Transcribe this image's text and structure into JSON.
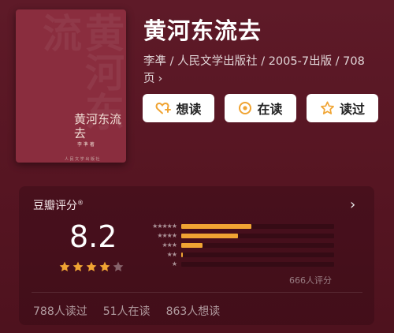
{
  "book": {
    "title": "黄河东流去",
    "meta_line": "李凖 / 人民文学出版社 / 2005-7出版 / 708页",
    "cover": {
      "title": "黄河东流去",
      "author": "李 凖 著",
      "publisher": "人 民 文 学 出 版 社"
    }
  },
  "actions": {
    "want_label": "想读",
    "reading_label": "在读",
    "read_label": "读过"
  },
  "rating": {
    "label": "豆瓣评分",
    "reg_mark": "®",
    "score": "8.2",
    "stars_filled": 4,
    "distribution": [
      {
        "stars": "★★★★★",
        "fraction": 0.46
      },
      {
        "stars": "★★★★",
        "fraction": 0.37
      },
      {
        "stars": "★★★",
        "fraction": 0.14
      },
      {
        "stars": "★★",
        "fraction": 0.01
      },
      {
        "stars": "★",
        "fraction": 0.0
      }
    ],
    "raters": "666人评分"
  },
  "stats": {
    "read": "788人读过",
    "reading": "51人在读",
    "want": "863人想读"
  },
  "colors": {
    "accent": "#f0a433",
    "background": "#5a1624",
    "button": "#ffffff"
  }
}
